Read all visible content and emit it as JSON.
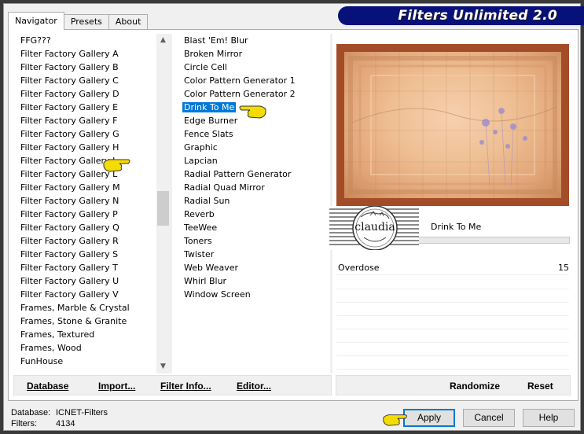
{
  "app": {
    "title": "Filters Unlimited 2.0"
  },
  "tabs": [
    {
      "label": "Navigator",
      "active": true
    },
    {
      "label": "Presets",
      "active": false
    },
    {
      "label": "About",
      "active": false
    }
  ],
  "categories": [
    "FFG???",
    "Filter Factory Gallery A",
    "Filter Factory Gallery B",
    "Filter Factory Gallery C",
    "Filter Factory Gallery D",
    "Filter Factory Gallery E",
    "Filter Factory Gallery F",
    "Filter Factory Gallery G",
    "Filter Factory Gallery H",
    "Filter Factory Gallery J",
    "Filter Factory Gallery L",
    "Filter Factory Gallery M",
    "Filter Factory Gallery N",
    "Filter Factory Gallery P",
    "Filter Factory Gallery Q",
    "Filter Factory Gallery R",
    "Filter Factory Gallery S",
    "Filter Factory Gallery T",
    "Filter Factory Gallery U",
    "Filter Factory Gallery V",
    "Frames, Marble & Crystal",
    "Frames, Stone & Granite",
    "Frames, Textured",
    "Frames, Wood",
    "FunHouse"
  ],
  "filters": [
    "Blast 'Em! Blur",
    "Broken Mirror",
    "Circle Cell",
    "Color Pattern Generator 1",
    "Color Pattern Generator 2",
    "Drink To Me",
    "Edge Burner",
    "Fence Slats",
    "Graphic",
    "Lapcian",
    "Radial Pattern Generator",
    "Radial Quad Mirror",
    "Radial Sun",
    "Reverb",
    "TeeWee",
    "Toners",
    "Twister",
    "Web Weaver",
    "Whirl Blur",
    "Window Screen"
  ],
  "selected_filter": "Drink To Me",
  "selected_category": "Filter Factory Gallery J",
  "params": [
    {
      "label": "Overdose",
      "value": "15"
    }
  ],
  "logo_text": "claudia",
  "toolbar": {
    "database": "Database",
    "import": "Import...",
    "filter_info": "Filter Info...",
    "editor": "Editor...",
    "randomize": "Randomize",
    "reset": "Reset"
  },
  "footer": {
    "database_label": "Database:",
    "database_value": "ICNET-Filters",
    "filters_label": "Filters:",
    "filters_value": "4134",
    "apply": "Apply",
    "cancel": "Cancel",
    "help": "Help"
  },
  "colors": {
    "banner": "#08107a",
    "selection": "#0078d7",
    "frame": "#a34d28",
    "pointer": "#f5dc00"
  }
}
